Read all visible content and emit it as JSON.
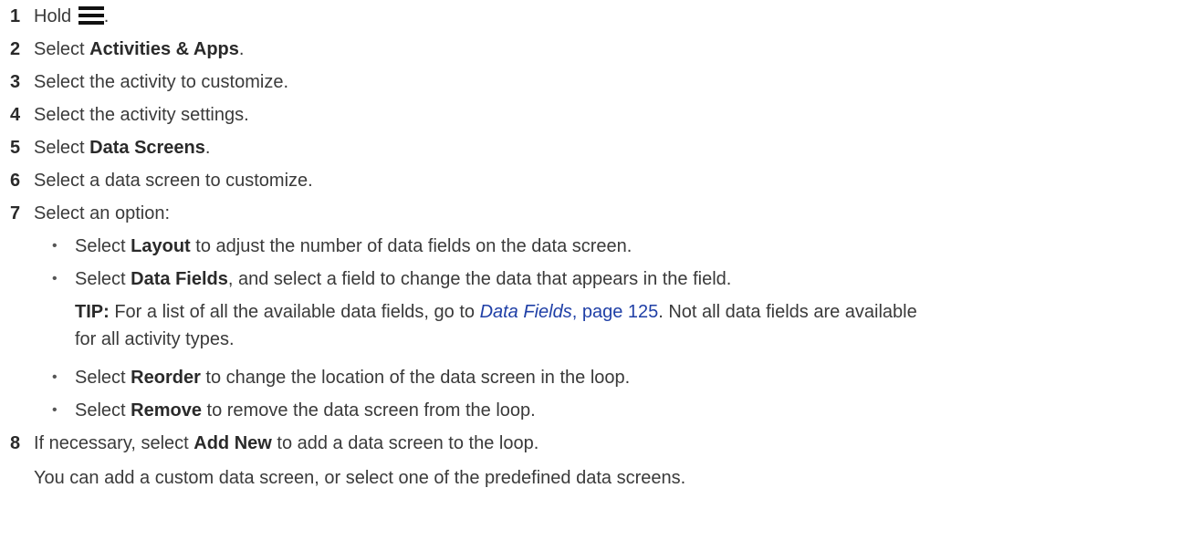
{
  "steps": [
    {
      "num": "1",
      "pre": "Hold ",
      "icon": "menu-icon",
      "post": "."
    },
    {
      "num": "2",
      "pre": "Select ",
      "bold": "Activities & Apps",
      "post": "."
    },
    {
      "num": "3",
      "text": "Select the activity to customize."
    },
    {
      "num": "4",
      "text": "Select the activity settings."
    },
    {
      "num": "5",
      "pre": "Select ",
      "bold": "Data Screens",
      "post": "."
    },
    {
      "num": "6",
      "text": "Select a data screen to customize."
    },
    {
      "num": "7",
      "text": "Select an option:"
    },
    {
      "num": "8",
      "pre": "If necessary, select ",
      "bold": "Add New",
      "post": " to add a data screen to the loop."
    }
  ],
  "options": [
    {
      "bullet": "•",
      "pre": "Select ",
      "bold": "Layout",
      "post": " to adjust the number of data fields on the data screen."
    },
    {
      "bullet": "•",
      "pre": "Select ",
      "bold": "Data Fields",
      "post": ", and select a field to change the data that appears in the field."
    },
    {
      "bullet": "•",
      "pre": "Select ",
      "bold": "Reorder",
      "post": " to change the location of the data screen in the loop."
    },
    {
      "bullet": "•",
      "pre": "Select ",
      "bold": "Remove",
      "post": " to remove the data screen from the loop."
    }
  ],
  "tip": {
    "label": "TIP:",
    "pre": " For a list of all the available data fields, go to ",
    "link_title": "Data Fields",
    "link_page": ", page 125",
    "post": ". Not all data fields are available",
    "line2": "for all activity types."
  },
  "note8": "You can add a custom data screen, or select one of the predefined data screens."
}
